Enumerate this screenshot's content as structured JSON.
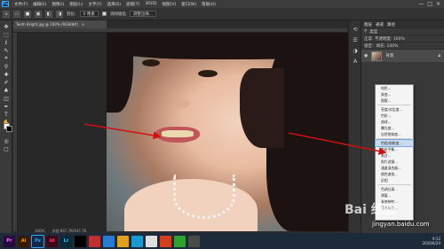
{
  "app": {
    "logo": "Ps"
  },
  "menubar": {
    "items": [
      "文件(F)",
      "编辑(E)",
      "图像(I)",
      "图层(L)",
      "文字(Y)",
      "选择(S)",
      "滤镜(T)",
      "3D(D)",
      "视图(V)",
      "窗口(W)",
      "帮助(H)"
    ],
    "window_controls": [
      "—",
      "□",
      "×"
    ]
  },
  "options_bar": {
    "feather_label": "羽化:",
    "feather_value": "0 像素",
    "antialias_label": "消除锯齿",
    "refine_button": "调整边缘..."
  },
  "document": {
    "tab_title": "Teeth Bright.jpg @ 100% (RGB/8#)",
    "close_icon": "×"
  },
  "status": {
    "zoom": "100%",
    "doc_info": "文档:947.7K/947.7K"
  },
  "layers_panel": {
    "tabs": [
      "图层",
      "通道",
      "路径"
    ],
    "search_label": "类型",
    "blend_mode": "正常",
    "opacity_label": "不透明度: 100%",
    "lock_label": "锁定:",
    "fill_label": "填充: 100%",
    "layer_name": "背景"
  },
  "adjustment_menu": {
    "items": [
      "纯色...",
      "渐变...",
      "图案...",
      "亮度/对比度...",
      "色阶...",
      "曲线...",
      "曝光度...",
      "自然饱和度...",
      "色相/饱和度...",
      "色彩平衡...",
      "黑白...",
      "照片滤镜...",
      "通道混合器...",
      "颜色查找...",
      "反相",
      "色调分离...",
      "阈值...",
      "渐变映射...",
      "可选颜色..."
    ],
    "highlighted_index": 8
  },
  "taskbar": {
    "apps": [
      {
        "label": "Pr",
        "color": "#2a0a3a",
        "fg": "#e77cff"
      },
      {
        "label": "Ai",
        "color": "#331c00",
        "fg": "#ff9a00"
      },
      {
        "label": "Ps",
        "color": "#0e2a47",
        "fg": "#31a8ff"
      },
      {
        "label": "Id",
        "color": "#3a0a1a",
        "fg": "#ff3a79"
      },
      {
        "label": "Lr",
        "color": "#0a2a3a",
        "fg": "#31c5f0"
      },
      {
        "label": "",
        "color": "#000000",
        "fg": "#ffffff"
      },
      {
        "label": "",
        "color": "#c03030",
        "fg": "#ffffff"
      },
      {
        "label": "",
        "color": "#2a7ad0",
        "fg": "#ffffff"
      },
      {
        "label": "",
        "color": "#e0a020",
        "fg": "#ffffff"
      },
      {
        "label": "",
        "color": "#1a9ad0",
        "fg": "#ffffff"
      },
      {
        "label": "",
        "color": "#e0e0e0",
        "fg": "#333333"
      },
      {
        "label": "",
        "color": "#d04020",
        "fg": "#ffffff"
      },
      {
        "label": "",
        "color": "#30a030",
        "fg": "#ffffff"
      },
      {
        "label": "",
        "color": "#4a4a4a",
        "fg": "#ffffff"
      }
    ],
    "time": "9:12",
    "date": "2020/6/24"
  },
  "watermark": {
    "brand": "Bai 经验",
    "url": "jingyan.baidu.com"
  },
  "colors": {
    "arrow": "#d01010",
    "highlight": "#c8daf0"
  }
}
